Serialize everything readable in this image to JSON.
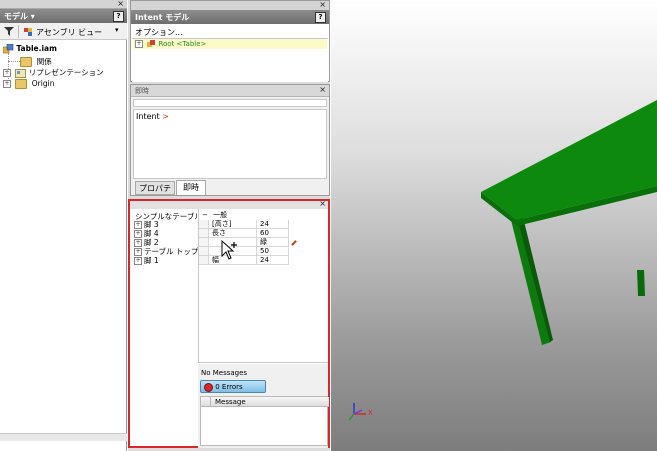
{
  "left_panel": {
    "title": "モデル ▾",
    "help": "?",
    "close": "×",
    "toolbar_view": "アセンブリ ビュー",
    "tree": [
      {
        "label": "Table.iam"
      },
      {
        "label": "関係"
      },
      {
        "label": "リプレゼンテーション"
      },
      {
        "label": "Origin"
      }
    ]
  },
  "intent_panel": {
    "title": "Intent モデル",
    "help": "?",
    "close": "×",
    "options": "オプション...",
    "root": "Root <Table>"
  },
  "immediate_panel": {
    "title": "即時",
    "close": "×",
    "prompt_text": "Intent",
    "tabs": [
      "プロパティ",
      "即時"
    ]
  },
  "design_panel": {
    "close": "×",
    "parts": [
      "シンプルなテーブル",
      "脚 3",
      "脚 4",
      "脚 2",
      "テーブル トップ",
      "脚 1"
    ],
    "group_label": "一般",
    "properties": [
      {
        "name": "[高さ]",
        "value": "24"
      },
      {
        "name": "長さ",
        "value": "60"
      },
      {
        "name": "",
        "value": "緑"
      },
      {
        "name": "",
        "value": "50"
      },
      {
        "name": "幅",
        "value": "24"
      }
    ],
    "no_messages": "No Messages",
    "errors_button": "0 Errors",
    "message_header": "Message"
  },
  "viewport": {
    "table_color": "#0d8a0d",
    "axis_x_label": "X",
    "highlight_color": "#d9262b"
  }
}
